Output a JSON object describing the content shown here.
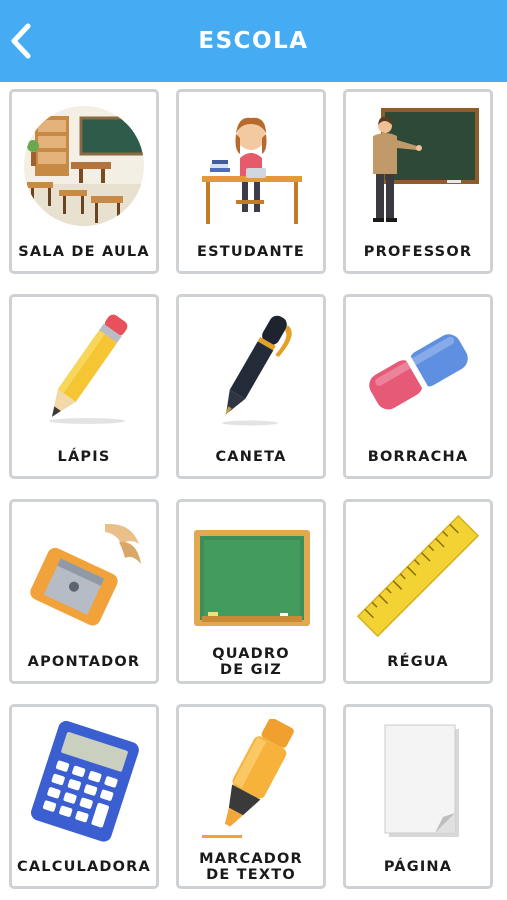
{
  "header": {
    "title": "ESCOLA",
    "back_icon": "chevron-left-icon",
    "color": "#45acf3"
  },
  "cards": [
    {
      "label": "SALA DE AULA",
      "icon": "classroom-image"
    },
    {
      "label": "ESTUDANTE",
      "icon": "student-image"
    },
    {
      "label": "PROFESSOR",
      "icon": "teacher-image"
    },
    {
      "label": "LÁPIS",
      "icon": "pencil-image"
    },
    {
      "label": "CANETA",
      "icon": "pen-image"
    },
    {
      "label": "BORRACHA",
      "icon": "eraser-image"
    },
    {
      "label": "APONTADOR",
      "icon": "sharpener-image"
    },
    {
      "label": "QUADRO\nDE GIZ",
      "icon": "chalkboard-image"
    },
    {
      "label": "RÉGUA",
      "icon": "ruler-image"
    },
    {
      "label": "CALCULADORA",
      "icon": "calculator-image"
    },
    {
      "label": "MARCADOR\nDE TEXTO",
      "icon": "highlighter-image"
    },
    {
      "label": "PÁGINA",
      "icon": "page-image"
    }
  ]
}
